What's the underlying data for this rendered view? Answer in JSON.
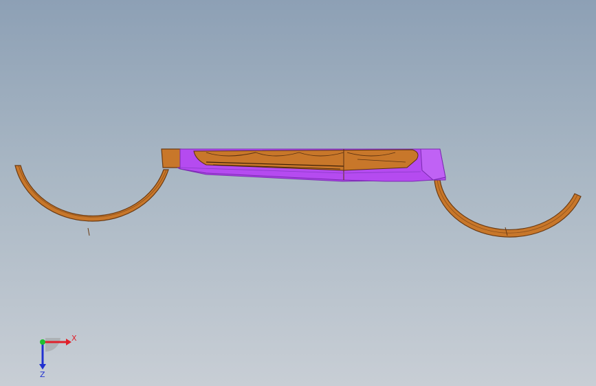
{
  "view": {
    "background_top": "#8da0b5",
    "background_bottom": "#c8ced5"
  },
  "model": {
    "colors": {
      "copper": "#c8772a",
      "copper_dark": "#6a3a12",
      "purple": "#b54bf0",
      "purple_dark": "#7a2ab0"
    }
  },
  "triad": {
    "x_label": "X",
    "z_label": "Z",
    "x_color": "#e0202a",
    "y_color": "#20c030",
    "z_color": "#2030d0"
  }
}
